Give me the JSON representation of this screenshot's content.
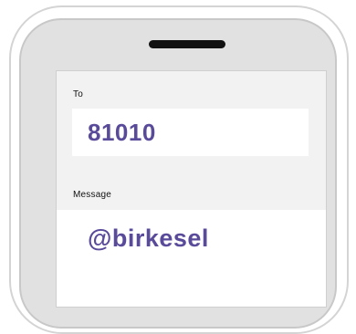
{
  "sms_form": {
    "to_label": "To",
    "to_value": "81010",
    "message_label": "Message",
    "message_value": "@birkesel"
  },
  "colors": {
    "value_text": "#5a4a9a",
    "screen_bg": "#f2f2f2",
    "phone_frame": "#e1e1e1"
  }
}
